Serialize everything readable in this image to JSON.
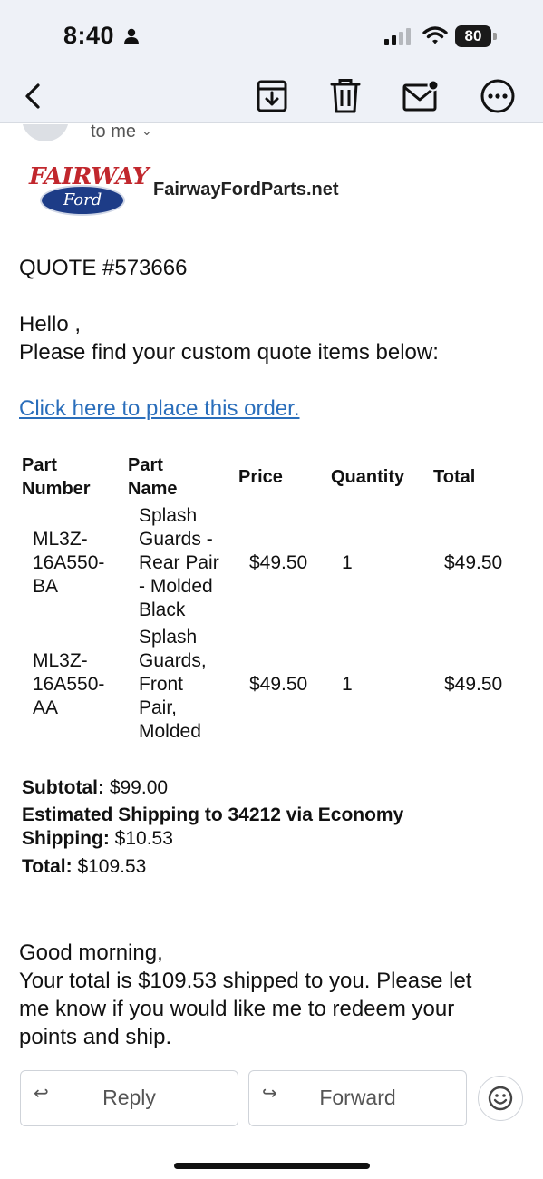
{
  "status_bar": {
    "time": "8:40",
    "battery": "80"
  },
  "toolbar": {
    "icons": [
      "back-icon",
      "archive-icon",
      "trash-icon",
      "mark-unread-icon",
      "more-icon"
    ]
  },
  "header": {
    "recipient": "to me"
  },
  "brand": {
    "logo_text": "FAIRWAY",
    "logo_badge": "Ford",
    "site": "FairwayFordParts.net"
  },
  "email": {
    "quote_title": "QUOTE #573666",
    "greeting": "Hello ,",
    "intro": "Please find your custom quote items below:",
    "order_link": "Click here to place this order."
  },
  "table": {
    "headers": {
      "part_number": [
        "Part",
        "Number"
      ],
      "part_name": [
        "Part",
        "Name"
      ],
      "price": "Price",
      "quantity": "Quantity",
      "total": "Total"
    },
    "rows": [
      {
        "part_number": [
          "ML3Z-",
          "16A550-",
          "BA"
        ],
        "part_name": [
          "Splash",
          "Guards -",
          "Rear Pair",
          "- Molded",
          "Black"
        ],
        "price": "$49.50",
        "quantity": "1",
        "total": "$49.50"
      },
      {
        "part_number": [
          "ML3Z-",
          "16A550-",
          "AA"
        ],
        "part_name": [
          "Splash",
          "Guards,",
          "Front",
          "Pair,",
          "Molded"
        ],
        "price": "$49.50",
        "quantity": "1",
        "total": "$49.50"
      }
    ]
  },
  "summary": {
    "subtotal_label": "Subtotal:",
    "subtotal_value": "$99.00",
    "shipping_label_1": "Estimated Shipping to 34212 via Economy",
    "shipping_label_2": "Shipping:",
    "shipping_value": "$10.53",
    "total_label": "Total:",
    "total_value": "$109.53"
  },
  "message": {
    "line1": "Good morning,",
    "line2": "Your total is $109.53 shipped to you. Please let",
    "line3": "me know if you would like me to redeem your",
    "line4": "points and ship."
  },
  "actions": {
    "reply": "Reply",
    "forward": "Forward",
    "reply_icon": "reply-icon",
    "forward_icon": "forward-icon",
    "emoji_icon": "emoji-icon"
  },
  "colors": {
    "link": "#2a6ebb",
    "toolbar_bg": "#eef1f7",
    "logo_red": "#c1272d",
    "ford_blue": "#1d3c87"
  }
}
